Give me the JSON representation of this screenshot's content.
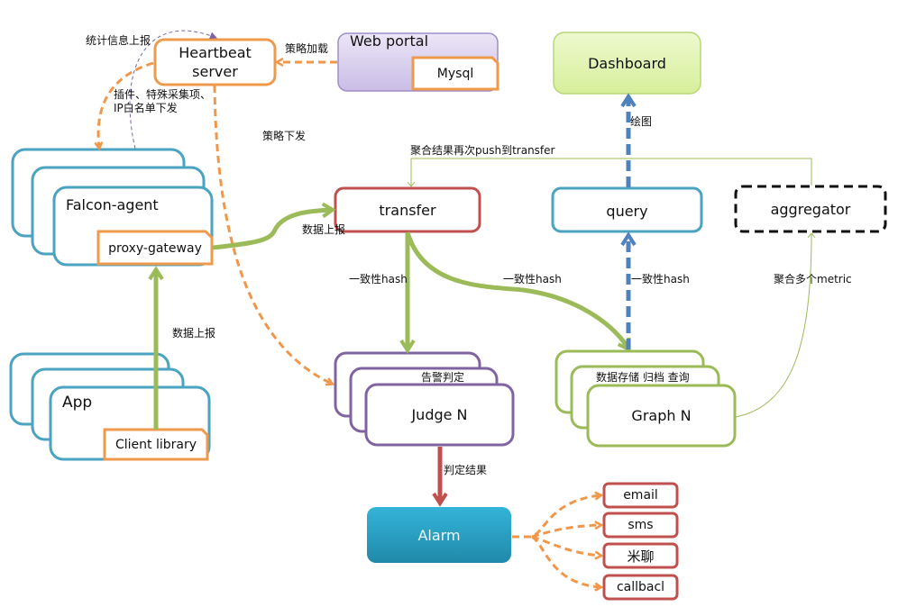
{
  "diagram": {
    "nodes": {
      "heartbeat": "Heartbeat server",
      "heartbeat_line1": "Heartbeat",
      "heartbeat_line2": "server",
      "web_portal": "Web portal",
      "mysql": "Mysql",
      "dashboard": "Dashboard",
      "falcon_agent": "Falcon-agent",
      "proxy_gateway": "proxy-gateway",
      "transfer": "transfer",
      "query": "query",
      "aggregator": "aggregator",
      "app": "App",
      "client_library": "Client library",
      "judge": "Judge N",
      "judge_caption": "告警判定",
      "graph": "Graph N",
      "graph_caption": "数据存储 归档 查询",
      "alarm": "Alarm",
      "email": "email",
      "sms": "sms",
      "mi_liao": "米聊",
      "callback": "callbacl"
    },
    "edge_labels": {
      "stats_report": "统计信息上报",
      "policy_load": "策略加载",
      "plugin_dispatch_line1": "插件、特殊采集项、",
      "plugin_dispatch_line2": "IP白名单下发",
      "policy_dispatch": "策略下发",
      "data_report_agent": "数据上报",
      "data_report_app": "数据上报",
      "hash_judge": "一致性hash",
      "hash_graph": "一致性hash",
      "hash_query": "一致性hash",
      "draw": "绘图",
      "agg_push": "聚合结果再次push到transfer",
      "agg_metrics": "聚合多个metric",
      "judge_result": "判定结果"
    },
    "colors": {
      "agent_border": "#4aa3c0",
      "heartbeat_border": "#ee9a4d",
      "judge_border": "#8064a2",
      "graph_border": "#9bbb59",
      "transfer_border": "#c0504d",
      "query_border": "#4aa3c0",
      "alarm_fill": "#2ea6c8",
      "dashboard_fill": "#e4f5b8",
      "webportal_fill": "#dcd4ef",
      "green_arrow": "#9bbb59",
      "orange_arrow": "#f0974a",
      "blue_arrow": "#4f81bd",
      "red_arrow": "#c0504d"
    }
  }
}
